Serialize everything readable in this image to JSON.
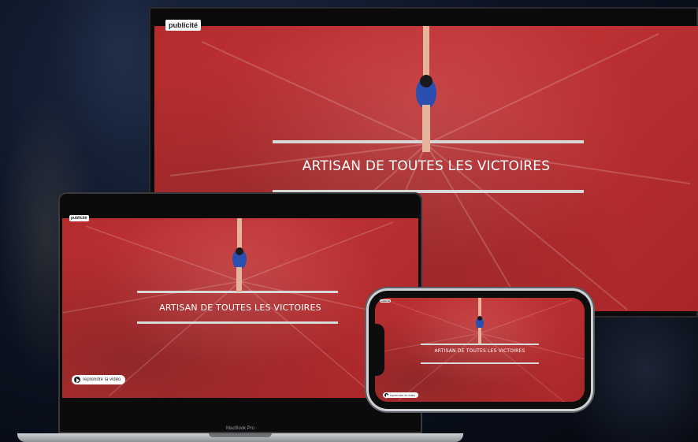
{
  "ad_badge": "publicité",
  "headline": "ARTISAN DE TOUTES LES VICTOIRES",
  "resume_button": "reprendre la vidéo",
  "laptop_brand": "MacBook Pro",
  "colors": {
    "scene_red": "#b52c2e",
    "athlete_blue": "#2a4fb0"
  }
}
